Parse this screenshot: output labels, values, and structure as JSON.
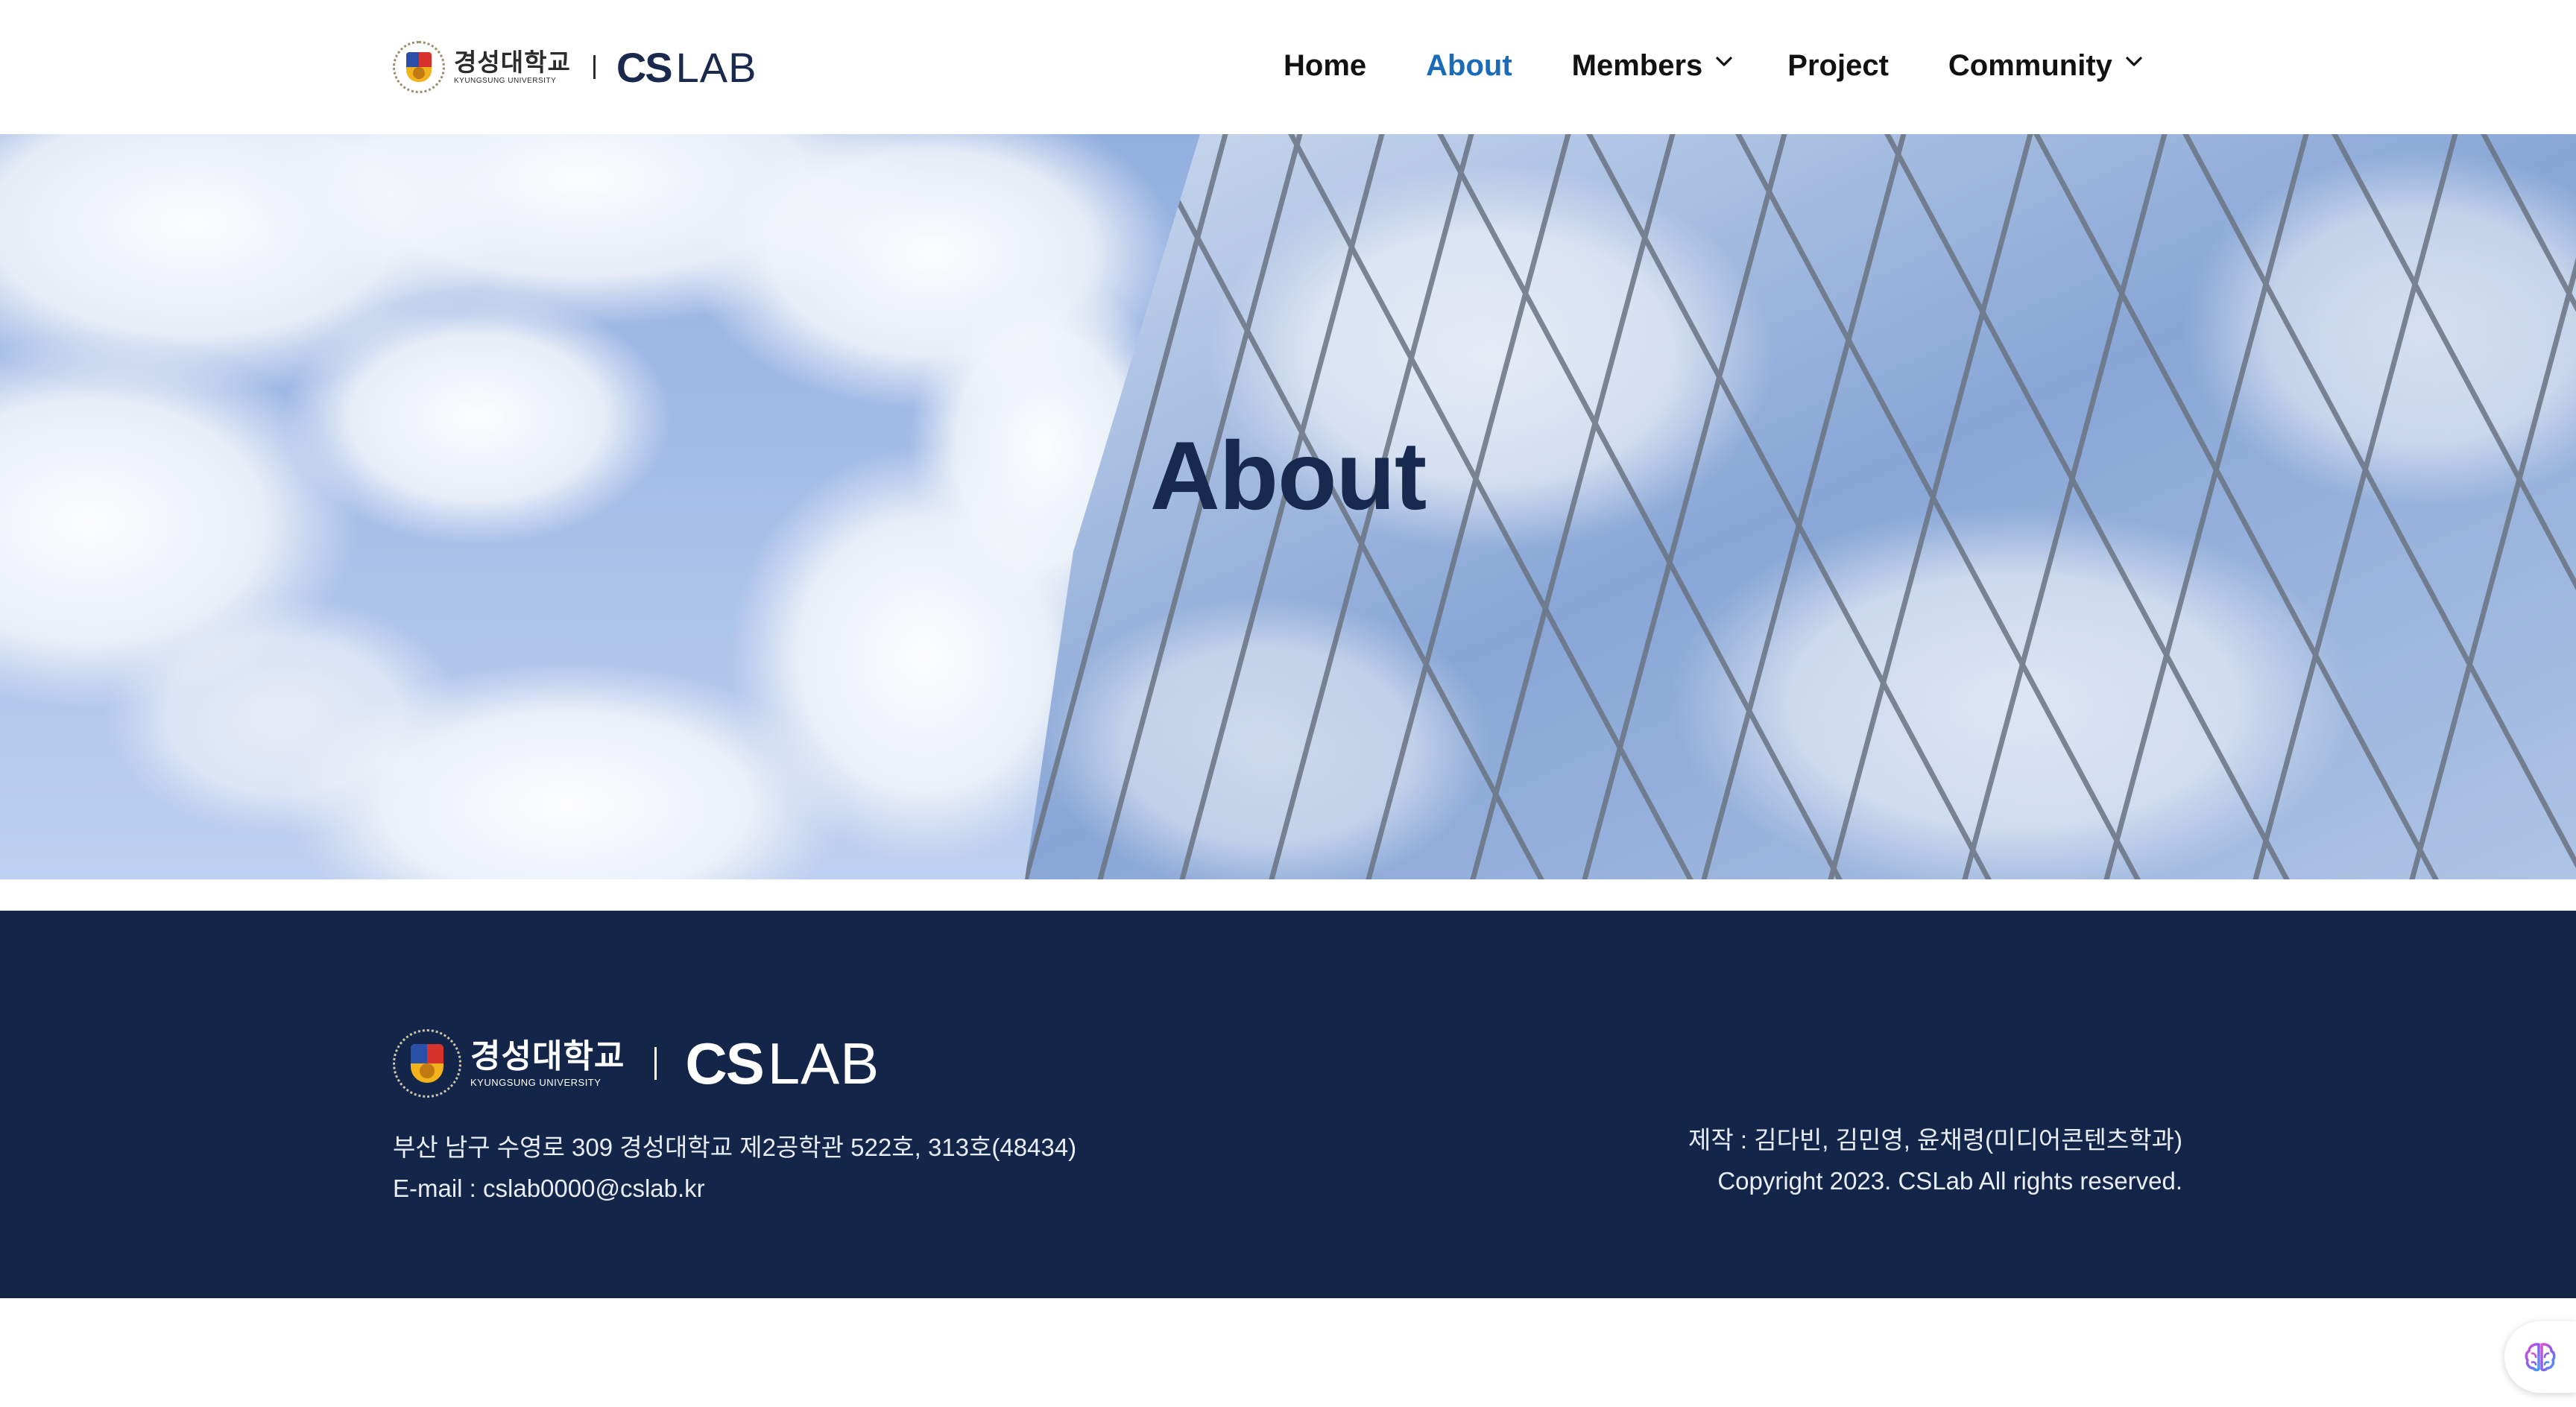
{
  "header": {
    "logo": {
      "university_ko": "경성대학교",
      "university_en": "KYUNGSUNG UNIVERSITY",
      "lab_cs": "CS",
      "lab_lab": "LAB"
    },
    "nav": [
      {
        "label": "Home",
        "active": false,
        "dropdown": false
      },
      {
        "label": "About",
        "active": true,
        "dropdown": false
      },
      {
        "label": "Members",
        "active": false,
        "dropdown": true
      },
      {
        "label": "Project",
        "active": false,
        "dropdown": false
      },
      {
        "label": "Community",
        "active": false,
        "dropdown": true
      }
    ]
  },
  "hero": {
    "title": "About"
  },
  "footer": {
    "logo": {
      "university_ko": "경성대학교",
      "university_en": "KYUNGSUNG UNIVERSITY",
      "lab_cs": "CS",
      "lab_lab": "LAB"
    },
    "address": "부산 남구 수영로 309 경성대학교 제2공학관 522호, 313호(48434)",
    "email": "E-mail : cslab0000@cslab.kr",
    "credits": "제작 : 김다빈, 김민영, 윤채령(미디어콘텐츠학과)",
    "copyright": "Copyright 2023. CSLab All rights reserved."
  },
  "widget": {
    "icon": "brain-icon"
  },
  "colors": {
    "accent": "#1a6bb8",
    "title": "#17294f",
    "footer_bg": "#13264a"
  }
}
